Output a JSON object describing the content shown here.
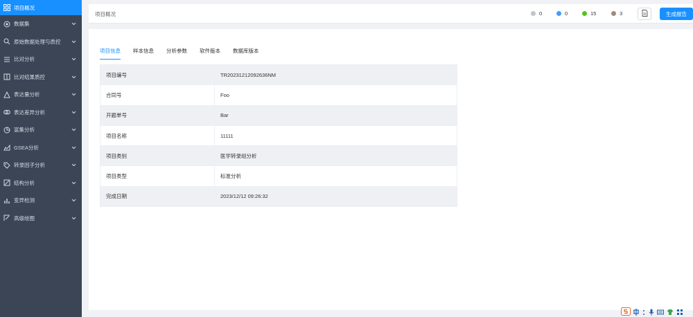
{
  "sidebar": {
    "items": [
      {
        "label": "项目概况",
        "icon": "grid-icon",
        "active": true
      },
      {
        "label": "数据集",
        "icon": "disc-icon"
      },
      {
        "label": "原始数据处理与质控",
        "icon": "settings-search-icon"
      },
      {
        "label": "比对分析",
        "icon": "list-icon"
      },
      {
        "label": "比对结果质控",
        "icon": "compare-icon"
      },
      {
        "label": "表达量分析",
        "icon": "triangle-icon"
      },
      {
        "label": "表达差异分析",
        "icon": "circles-icon"
      },
      {
        "label": "富集分析",
        "icon": "target-icon"
      },
      {
        "label": "GSEA分析",
        "icon": "area-chart-icon"
      },
      {
        "label": "转录因子分析",
        "icon": "tag-icon"
      },
      {
        "label": "结构分析",
        "icon": "structure-icon"
      },
      {
        "label": "变异检测",
        "icon": "bars-icon"
      },
      {
        "label": "高级绘图",
        "icon": "draw-icon"
      }
    ]
  },
  "header": {
    "breadcrumb": "项目概况",
    "stats": [
      {
        "value": "0",
        "color": "#c0c4cc"
      },
      {
        "value": "0",
        "color": "#409eff"
      },
      {
        "value": "15",
        "color": "#52c41a"
      },
      {
        "value": "3",
        "color": "#a08a7a"
      }
    ],
    "report_button": "生成报告"
  },
  "tabs": [
    {
      "label": "项目信息",
      "active": true
    },
    {
      "label": "样本信息"
    },
    {
      "label": "分析参数"
    },
    {
      "label": "软件版本"
    },
    {
      "label": "数据库版本"
    }
  ],
  "project_info": [
    {
      "key": "项目编号",
      "value": "TR20231212092636NM"
    },
    {
      "key": "合同号",
      "value": "Foo"
    },
    {
      "key": "开题单号",
      "value": "Bar"
    },
    {
      "key": "项目名称",
      "value": "11111"
    },
    {
      "key": "项目类别",
      "value": "医学转录组分析"
    },
    {
      "key": "项目类型",
      "value": "标准分析"
    },
    {
      "key": "完成日期",
      "value": "2023/12/12 09:26:32"
    }
  ],
  "colors": {
    "sidebar_bg": "#3b4556",
    "accent": "#1890ff"
  }
}
